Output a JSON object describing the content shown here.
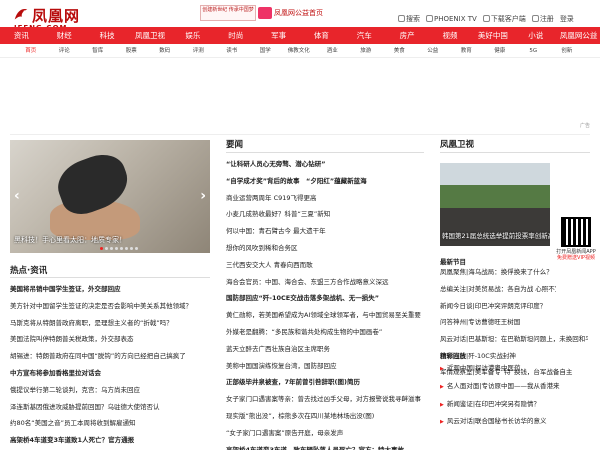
{
  "header": {
    "logo_cn": "凤凰网",
    "logo_en": "IFENG.COM",
    "promo_left": "创建新世纪 传承中国梦",
    "promo_right": "凤凰网公益首页",
    "top_links": [
      "搜索",
      "PHOENIX TV",
      "下载客户端",
      "注册",
      "登录"
    ]
  },
  "nav": [
    "资讯",
    "财经",
    "科技",
    "凤凰卫视",
    "娱乐",
    "时尚",
    "军事",
    "体育",
    "汽车",
    "房产",
    "视频",
    "美好中国",
    "小说",
    "凤凰网公益"
  ],
  "subnav": [
    "首页",
    "评论",
    "智库",
    "股票",
    "数码",
    "评测",
    "读书",
    "国学",
    "佛教文化",
    "酒业",
    "旅游",
    "美食",
    "公益",
    "教育",
    "健康",
    "5G",
    "创新"
  ],
  "ad_label": "广告",
  "carousel": {
    "caption": "黑科技！手心里看太阳：地质专家！",
    "dot_count": 8
  },
  "hot": {
    "title": "热点·资讯",
    "items": [
      {
        "text": "美国将吊销中国学生签证，外交部回应",
        "bold": true
      },
      {
        "text": "美方针对中国留学生签证的决定是否会影响中美关系其他领域？",
        "bold": false
      },
      {
        "text": "马斯克将从特朗普政府离职，是理想主义者的“折戟”吗？",
        "bold": false
      },
      {
        "text": "美国法院叫停特朗普关税政策，外交部表态",
        "bold": false
      },
      {
        "text": "胡锡进：特朗普政府在同中国“脱钩”的方向已经把自己搞疯了",
        "bold": false
      },
      {
        "text": "中方宣布将参加香格里拉对话会",
        "bold": true
      },
      {
        "text": "俄提议举行第二轮谈判，克宫：乌方尚未回应",
        "bold": false
      },
      {
        "text": "泽连斯基因俄进攻威胁提前回国？乌驻德大使馆否认",
        "bold": false
      },
      {
        "text": "约80名“美国之音”员工本周将收到解雇通知",
        "bold": false
      },
      {
        "text": "高架桥4车道变3车道致1人死亡？官方通报",
        "bold": true
      },
      {
        "text": "没有女爸爸被公开批评“技术”，一位高校职工称",
        "bold": false
      }
    ]
  },
  "news": {
    "title": "要闻",
    "items": [
      {
        "text": "“让科研人员心无旁骛、潜心钻研”",
        "bold": true
      },
      {
        "text": "“自学成才奖”背后的故事　“夕阳红”蕴藏新蓝海",
        "bold": true
      },
      {
        "text": "商业运营两周年 C919飞得更高",
        "bold": false
      },
      {
        "text": "小麦几成熟收最好？科普“三夏”新知",
        "bold": false
      },
      {
        "text": "何以中国：青石臂古今 最大遗干年",
        "bold": false
      },
      {
        "text": "想你的风吹到稀和合务区",
        "bold": false
      },
      {
        "text": "三代西安交大人 青春向西而歌",
        "bold": false
      },
      {
        "text": "海合会官员：中国、海合会、东盟三方合作战略意义深远",
        "bold": false
      },
      {
        "text": "国防部回应“歼-10CE交战击落多架战机、无一损失”",
        "bold": true
      },
      {
        "text": "黄仁勋称，若美国希望成为AI领域全球领军者，与中国贸易至关重要",
        "bold": false
      },
      {
        "text": "外媒老是翻腾：“多民族和谐共处构成生物的中国画卷”",
        "bold": false
      },
      {
        "text": "蓝天立醉去广西壮族自治区主席职务",
        "bold": false
      },
      {
        "text": "美称中国国演练恢复台湾，国防部回应",
        "bold": false
      },
      {
        "text": "正部级毕井泉被查，7年前曾引咎辞职(图)简历",
        "bold": true
      },
      {
        "text": "女子家门口遇害案等亲：曾去找过凶手父母，对方报警说我寻衅滋事",
        "bold": false
      },
      {
        "text": "现实版“熊出没”，棕熊多次在四川某地林场出没(图)",
        "bold": false
      },
      {
        "text": "“女子家门口遇害案”原告开庭，母亲发声",
        "bold": false
      },
      {
        "text": "高架桥4车道变3车道，致车辆坠落人员死亡？官方：特大事故",
        "bold": true
      }
    ]
  },
  "phoenix_tv": {
    "title": "凤凰卫视",
    "photo_caption": "韩国第21届总统选举提前投票率创新高",
    "qr_text": [
      "打开凤凰新闻APP",
      "免费赠送VIP视频"
    ],
    "program_title": "最新节目",
    "programs": [
      "凤凰聚焦|海乌战局：换俘换来了什么？",
      "总编关注|对美贸易战：各自为战 心照不宣",
      "新闻今日谈|印巴冲突评朗克评印度？"
    ],
    "programs2": [
      "问答神州|专访曹德旺王树国",
      "风云对话|巴基斯坦：在巴勒斯坦问题上，未换回和平",
      "全球连线|歼-10C实战封神",
      "军情观察室|美军备专“特”换钱，台军战备自主"
    ],
    "picks_title": "精彩回放",
    "picks": [
      "近观中国|探访港粤中医药",
      "名人面对面|专访原中国——我从香港来",
      "新闻鉴证|在印巴冲突另有隐情？",
      "风云对话|联合国秘书长访华的意义"
    ]
  }
}
